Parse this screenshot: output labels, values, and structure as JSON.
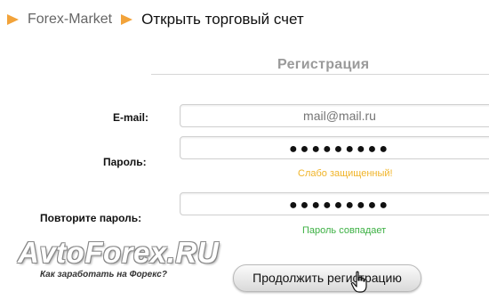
{
  "breadcrumb": {
    "items": [
      {
        "label": "Forex-Market"
      },
      {
        "label": "Открыть торговый счет"
      }
    ]
  },
  "form": {
    "title": "Регистрация",
    "email": {
      "label": "E-mail:",
      "placeholder": "mail@mail.ru"
    },
    "password": {
      "label": "Пароль:",
      "value": "●●●●●●●●●",
      "hint": "Слабо защищенный!"
    },
    "password_repeat": {
      "label": "Повторите пароль:",
      "value": "●●●●●●●●●",
      "hint": "Пароль совпадает"
    },
    "continue_label": "Продолжить регистрацию"
  },
  "watermark": {
    "logo_text": "AvtoForex.RU",
    "tagline": "Как заработать на Форекс?"
  },
  "colors": {
    "accent_orange": "#f2a33a",
    "hint_weak": "#f0b429",
    "hint_ok": "#3cb043",
    "title_gray": "#9a9a9a"
  },
  "icons": {
    "breadcrumb_separator": "orange-arrow-icon",
    "cursor": "hand-pointer-icon"
  }
}
